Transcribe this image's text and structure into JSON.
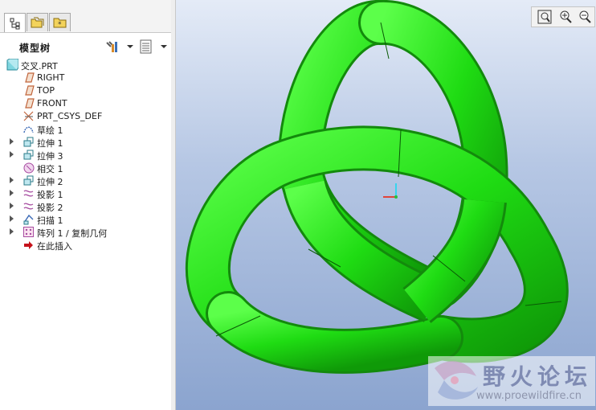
{
  "panel": {
    "title": "模型树",
    "tabs": [
      {
        "name": "model-tree-tab",
        "icon": "model-tree-icon"
      },
      {
        "name": "folder-browser-tab",
        "icon": "folder-browser-icon"
      },
      {
        "name": "favorites-tab",
        "icon": "favorites-icon"
      }
    ],
    "tools": [
      "settings-icon",
      "show-options-icon"
    ]
  },
  "tree": {
    "root": "交叉.PRT",
    "items": [
      {
        "label": "RIGHT",
        "icon": "datum-plane-icon",
        "expandable": false
      },
      {
        "label": "TOP",
        "icon": "datum-plane-icon",
        "expandable": false
      },
      {
        "label": "FRONT",
        "icon": "datum-plane-icon",
        "expandable": false
      },
      {
        "label": "PRT_CSYS_DEF",
        "icon": "coordinate-system-icon",
        "expandable": false
      },
      {
        "label": "草绘 1",
        "icon": "sketch-icon",
        "expandable": false
      },
      {
        "label": "拉伸 1",
        "icon": "extrude-icon",
        "expandable": true
      },
      {
        "label": "拉伸 3",
        "icon": "extrude-icon",
        "expandable": true
      },
      {
        "label": "相交 1",
        "icon": "intersect-icon",
        "expandable": false
      },
      {
        "label": "拉伸 2",
        "icon": "extrude-icon",
        "expandable": true
      },
      {
        "label": "投影 1",
        "icon": "projection-icon",
        "expandable": true
      },
      {
        "label": "投影 2",
        "icon": "projection-icon",
        "expandable": true
      },
      {
        "label": "扫描 1",
        "icon": "sweep-icon",
        "expandable": true
      },
      {
        "label": "阵列 1 / 复制几何",
        "icon": "pattern-icon",
        "expandable": true
      },
      {
        "label": "在此插入",
        "icon": "insert-here-arrow-icon",
        "expandable": false
      }
    ]
  },
  "viewport": {
    "tools": [
      "refit-icon",
      "zoom-in-icon",
      "zoom-out-icon"
    ],
    "model_color": "#1fdc13"
  },
  "watermark": {
    "chinese": "野火论坛",
    "url": "www.proewildfire.cn"
  }
}
